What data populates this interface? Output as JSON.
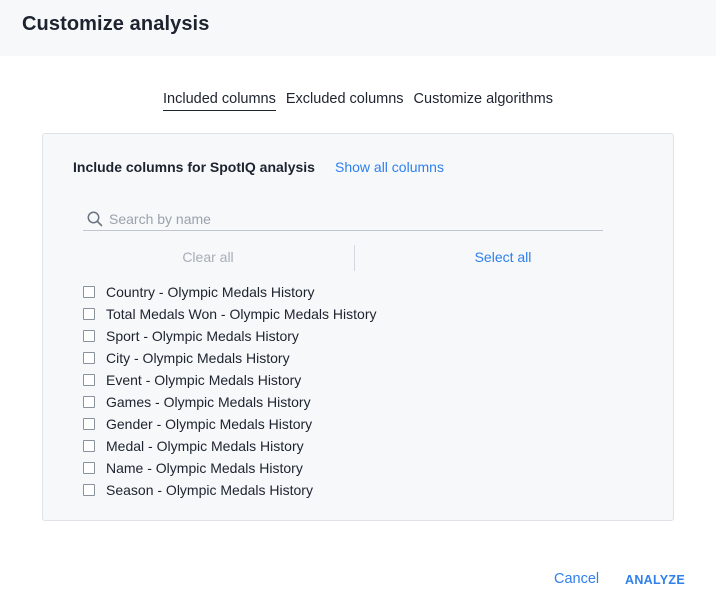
{
  "dialog": {
    "title": "Customize analysis"
  },
  "tabs": [
    {
      "label": "Included columns",
      "active": true
    },
    {
      "label": "Excluded columns",
      "active": false
    },
    {
      "label": "Customize algorithms",
      "active": false
    }
  ],
  "panel": {
    "title": "Include columns for SpotIQ analysis",
    "show_all_link": "Show all columns",
    "search": {
      "placeholder": "Search by name",
      "value": ""
    },
    "clear_all_label": "Clear all",
    "select_all_label": "Select all",
    "columns": [
      {
        "label": "Country - Olympic Medals History",
        "checked": false
      },
      {
        "label": "Total Medals Won - Olympic Medals History",
        "checked": false
      },
      {
        "label": "Sport - Olympic Medals History",
        "checked": false
      },
      {
        "label": "City - Olympic Medals History",
        "checked": false
      },
      {
        "label": "Event - Olympic Medals History",
        "checked": false
      },
      {
        "label": "Games - Olympic Medals History",
        "checked": false
      },
      {
        "label": "Gender - Olympic Medals History",
        "checked": false
      },
      {
        "label": "Medal - Olympic Medals History",
        "checked": false
      },
      {
        "label": "Name - Olympic Medals History",
        "checked": false
      },
      {
        "label": "Season - Olympic Medals History",
        "checked": false
      }
    ]
  },
  "footer": {
    "cancel_label": "Cancel",
    "analyze_label": "ANALYZE"
  },
  "colors": {
    "accent": "#2f80ed",
    "text": "#1d232f",
    "panel_bg": "#f6f8fa"
  },
  "icons": {
    "search": "search-icon"
  }
}
